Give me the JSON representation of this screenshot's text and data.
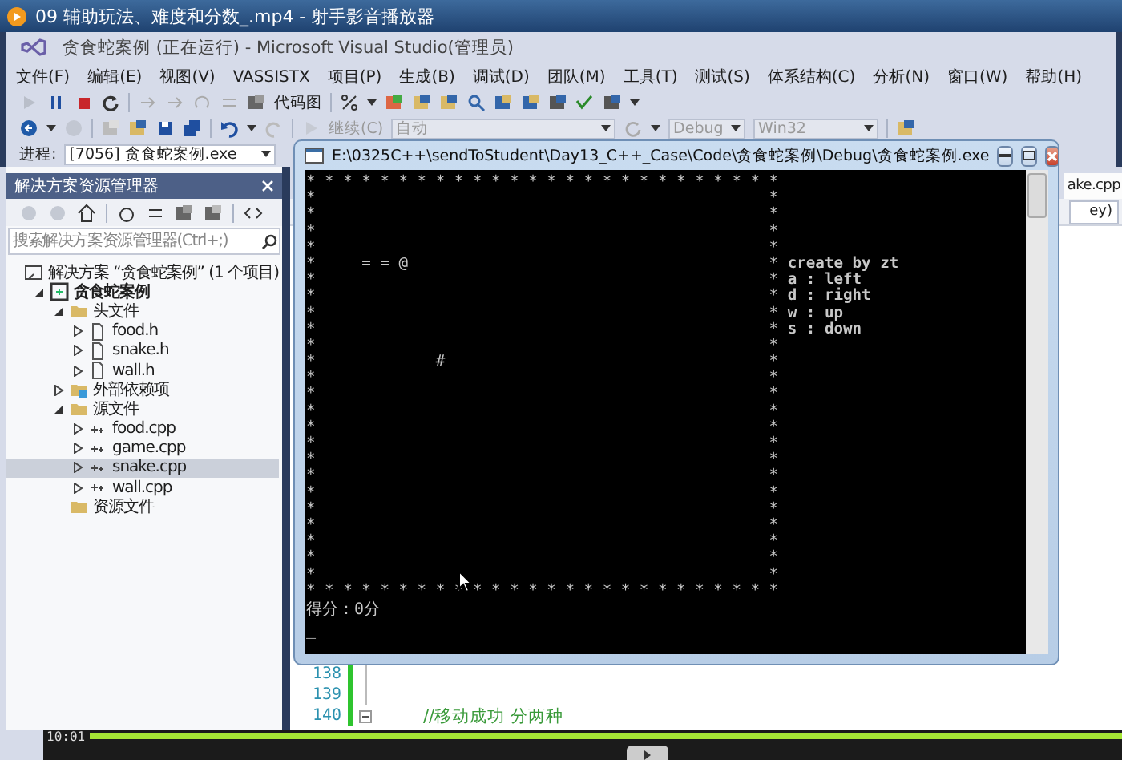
{
  "player": {
    "title": "09 辅助玩法、难度和分数_.mp4 - 射手影音播放器",
    "time": "10:01",
    "progress": {
      "level": 1
    }
  },
  "vs": {
    "title": "贪食蛇案例 (正在运行) - Microsoft Visual Studio(管理员)",
    "menu": [
      "文件(F)",
      "编辑(E)",
      "视图(V)",
      "VASSISTX",
      "项目(P)",
      "生成(B)",
      "调试(D)",
      "团队(M)",
      "工具(T)",
      "测试(S)",
      "体系结构(C)",
      "分析(N)",
      "窗口(W)",
      "帮助(H)"
    ],
    "toolbar1": {
      "code_map": "代码图"
    },
    "toolbar2": {
      "continue": "继续(C)",
      "auto": "自动",
      "config": "Debug",
      "platform": "Win32"
    },
    "process": {
      "label": "进程:",
      "value": "[7056] 贪食蛇案例.exe"
    }
  },
  "solution_explorer": {
    "title": "解决方案资源管理器",
    "search": {
      "placeholder": "搜索解决方案资源管理器(Ctrl+;)"
    },
    "tree": [
      {
        "label": "解决方案 “贪食蛇案例” (1 个项目)",
        "kind": "solution",
        "selected": false,
        "children": [
          {
            "label": "贪食蛇案例",
            "kind": "project",
            "expanded": true,
            "selected": false,
            "children": [
              {
                "label": "头文件",
                "kind": "folder",
                "expanded": true,
                "selected": false,
                "children": [
                  {
                    "label": "food.h",
                    "kind": "header",
                    "expanded": false,
                    "selected": false
                  },
                  {
                    "label": "snake.h",
                    "kind": "header",
                    "expanded": false,
                    "selected": false
                  },
                  {
                    "label": "wall.h",
                    "kind": "header",
                    "expanded": false,
                    "selected": false
                  }
                ]
              },
              {
                "label": "外部依赖项",
                "kind": "references",
                "expanded": false,
                "selected": false
              },
              {
                "label": "源文件",
                "kind": "folder",
                "expanded": true,
                "selected": false,
                "children": [
                  {
                    "label": "food.cpp",
                    "kind": "source",
                    "expanded": false,
                    "selected": false
                  },
                  {
                    "label": "game.cpp",
                    "kind": "source",
                    "expanded": false,
                    "selected": false
                  },
                  {
                    "label": "snake.cpp",
                    "kind": "source",
                    "expanded": false,
                    "selected": true
                  },
                  {
                    "label": "wall.cpp",
                    "kind": "source",
                    "expanded": false,
                    "selected": false
                  }
                ]
              },
              {
                "label": "资源文件",
                "kind": "folder",
                "selected": false
              }
            ]
          }
        ]
      }
    ]
  },
  "editor": {
    "tab_fragment": "ake.cpp",
    "member_fragment": "ey)",
    "lines": [
      {
        "number": "138",
        "foldable": false
      },
      {
        "number": "139",
        "foldable": false
      },
      {
        "number": "140",
        "text": "//移动成功 分两种",
        "foldable": true
      }
    ]
  },
  "console": {
    "title": "E:\\0325C++\\sendToStudent\\Day13_C++_Case\\Code\\贪食蛇案例\\Debug\\贪食蛇案例.exe",
    "board": {
      "top": "* * * * * * * * * * * * * * * * * * * * * * * * * *",
      "rows": [
        {
          "left": "*",
          "right": "*"
        },
        {
          "left": "*",
          "right": "*"
        },
        {
          "left": "*",
          "right": "*"
        },
        {
          "left": "*",
          "right": "*"
        },
        {
          "left": "*",
          "inner": "     = = @",
          "right": "*",
          "note": "create by zt"
        },
        {
          "left": "*",
          "right": "*",
          "note": "a : left"
        },
        {
          "left": "*",
          "right": "*",
          "note": "d : right"
        },
        {
          "left": "*",
          "right": "*",
          "note": "w : up"
        },
        {
          "left": "*",
          "right": "*",
          "note": "s : down"
        },
        {
          "left": "*",
          "right": "*"
        },
        {
          "left": "*",
          "inner": "             #",
          "right": "*"
        },
        {
          "left": "*",
          "right": "*"
        },
        {
          "left": "*",
          "right": "*"
        },
        {
          "left": "*",
          "right": "*"
        },
        {
          "left": "*",
          "right": "*"
        },
        {
          "left": "*",
          "right": "*"
        },
        {
          "left": "*",
          "right": "*"
        },
        {
          "left": "*",
          "right": "*"
        },
        {
          "left": "*",
          "right": "*"
        },
        {
          "left": "*",
          "right": "*"
        },
        {
          "left": "*",
          "right": "*"
        },
        {
          "left": "*",
          "right": "*"
        },
        {
          "left": "*",
          "right": "*"
        },
        {
          "left": "*",
          "right": "*"
        }
      ],
      "bottom": "* * * * * * * * * * * * * * * * * * * * * * * * * *"
    },
    "score": "得分：0分",
    "prompt": "_"
  }
}
